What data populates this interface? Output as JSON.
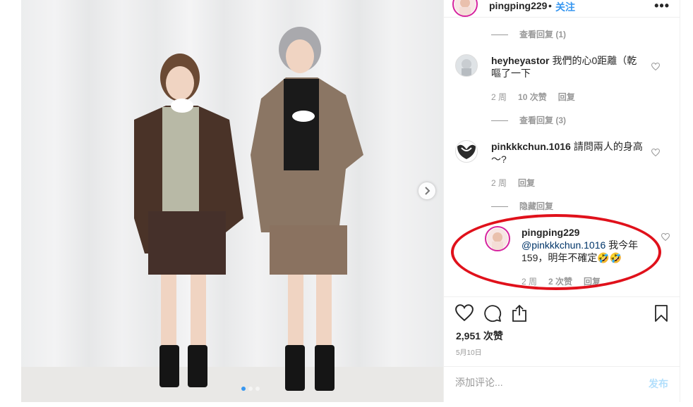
{
  "header": {
    "username": "pingping229",
    "separator": "•",
    "follow_label": "关注",
    "more_label": "•••"
  },
  "comments": {
    "top_view_replies": "查看回复 (1)",
    "items": [
      {
        "username": "heyheyastor",
        "text": "我們的心0距離（乾嘔了一下",
        "time": "2 周",
        "likes": "10 次赞",
        "reply_label": "回复",
        "view_replies": "查看回复 (3)"
      },
      {
        "username": "pinkkkchun.1016",
        "text": "請問兩人的身高～?",
        "time": "2 周",
        "reply_label": "回复",
        "view_replies": "隐藏回复"
      }
    ],
    "reply": {
      "username": "pingping229",
      "mention": "@pinkkkchun.1016",
      "text": " 我今年159，明年不確定🤣🤣",
      "time": "2 周",
      "likes": "2 次赞",
      "reply_label": "回复"
    }
  },
  "actions": {
    "likes": "2,951 次赞",
    "date": "5月10日"
  },
  "add_comment": {
    "placeholder": "添加评论...",
    "post_label": "发布"
  },
  "colors": {
    "accent": "#3897f0",
    "highlight_circle": "#e0111b",
    "muted": "#999999",
    "post_disabled": "#b2dffc"
  },
  "icons": [
    "chevron-right-icon",
    "heart-icon",
    "comment-icon",
    "share-icon",
    "bookmark-icon",
    "more-icon"
  ]
}
